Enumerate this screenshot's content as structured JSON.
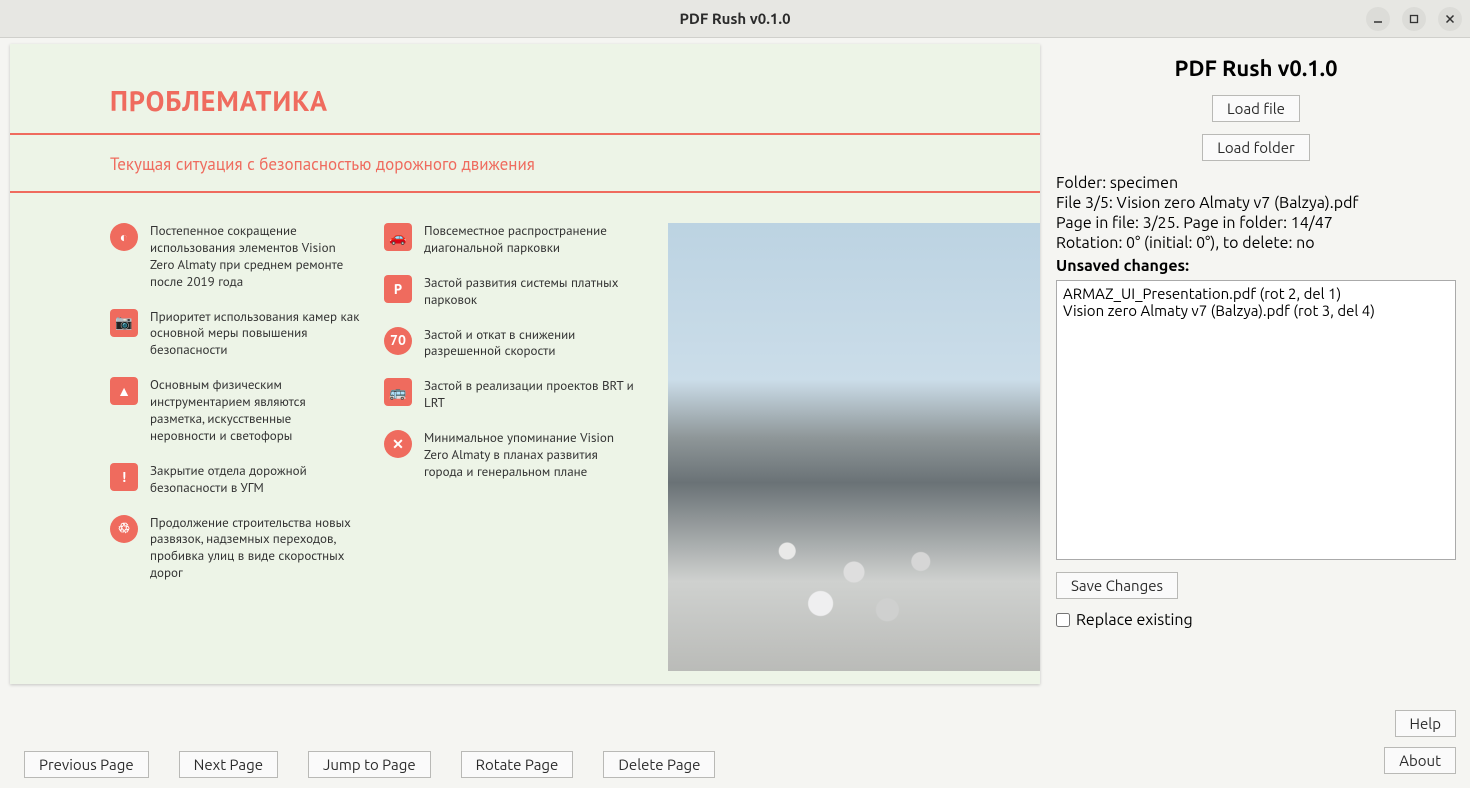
{
  "window": {
    "title": "PDF Rush v0.1.0"
  },
  "preview": {
    "heading": "ПРОБЛЕМАТИКА",
    "subheading": "Текущая ситуация с безопасностью дорожного движения",
    "left_items": [
      "Постепенное сокращение использования элементов Vision Zero Almaty при среднем ремонте после 2019 года",
      "Приоритет использования камер как основной меры повышения безопасности",
      "Основным физическим инструментарием являются разметка, искусственные неровности и светофоры",
      "Закрытие отдела дорожной безопасности в УГМ",
      "Продолжение строительства новых развязок, надземных переходов, пробивка улиц в виде скоростных дорог"
    ],
    "right_items": [
      "Повсеместное распространение диагональной парковки",
      "Застой развития системы платных парковок",
      "Застой и откат в снижении разрешенной скорости",
      "Застой в реализации проектов BRT и LRT",
      "Минимальное упоминание Vision Zero Almaty в планах развития города и генеральном плане"
    ]
  },
  "toolbar": {
    "prev": "Previous Page",
    "next": "Next Page",
    "jump": "Jump to Page",
    "rotate": "Rotate Page",
    "delete": "Delete Page"
  },
  "sidebar": {
    "title": "PDF Rush v0.1.0",
    "load_file": "Load file",
    "load_folder": "Load folder",
    "folder_line": "Folder: specimen",
    "file_line": "File 3/5: Vision zero Almaty v7 (Balzya).pdf",
    "page_line": "Page in file: 3/25. Page in folder: 14/47",
    "rotation_line": "Rotation: 0° (initial: 0°), to delete: no",
    "unsaved_label": "Unsaved changes:",
    "changes": [
      "ARMAZ_UI_Presentation.pdf (rot 2, del 1)",
      "Vision zero Almaty v7 (Balzya).pdf (rot 3, del 4)"
    ],
    "save": "Save Changes",
    "replace": "Replace existing",
    "help": "Help",
    "about": "About"
  }
}
